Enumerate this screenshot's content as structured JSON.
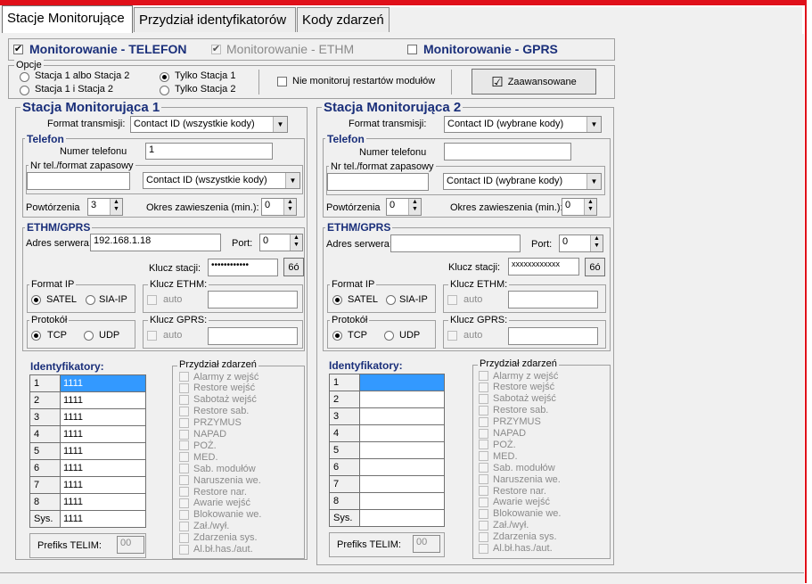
{
  "tabs": [
    {
      "label": "Stacje Monitorujące",
      "active": true
    },
    {
      "label": "Przydział identyfikatorów",
      "active": false
    },
    {
      "label": "Kody zdarzeń",
      "active": false
    }
  ],
  "monitoring": {
    "telefon": {
      "label": "Monitorowanie - TELEFON",
      "checked": true
    },
    "ethm": {
      "label": "Monitorowanie - ETHM",
      "checked": true
    },
    "gprs": {
      "label": "Monitorowanie - GPRS",
      "checked": false
    }
  },
  "options": {
    "legend": "Opcje",
    "r1": "Stacja 1 albo Stacja 2",
    "r2": "Stacja 1 i Stacja 2",
    "r3": "Tylko Stacja 1",
    "r4": "Tylko Stacja 2",
    "no_restart": "Nie monitoruj restartów modułów",
    "advanced": "Zaawansowane"
  },
  "labels": {
    "format_transmisji": "Format transmisji:",
    "telefon": "Telefon",
    "numer_telefonu": "Numer telefonu",
    "nr_zapasowy": "Nr tel./format zapasowy",
    "powtorzenia": "Powtórzenia",
    "okres": "Okres zawieszenia (min.):",
    "ethm_gprs": "ETHM/GPRS",
    "adres": "Adres serwera:",
    "port": "Port:",
    "klucz_stacji": "Klucz stacji:",
    "format_ip": "Format IP",
    "satel": "SATEL",
    "siaip": "SIA-IP",
    "klucz_ethm": "Klucz ETHM:",
    "auto": "auto",
    "protokol": "Protokół",
    "tcp": "TCP",
    "udp": "UDP",
    "klucz_gprs": "Klucz GPRS:",
    "identyfikatory": "Identyfikatory:",
    "przydzial": "Przydział zdarzeń",
    "prefiks": "Prefiks TELIM:",
    "key_button": "6ó"
  },
  "events": [
    "Alarmy z wejść",
    "Restore wejść",
    "Sabotaż wejść",
    "Restore sab.",
    "PRZYMUS",
    "NAPAD",
    "POŻ.",
    "MED.",
    "Sab. modułów",
    "Naruszenia we.",
    "Restore nar.",
    "Awarie wejść",
    "Blokowanie we.",
    "Zał./wył.",
    "Zdarzenia sys.",
    "Al.bł.has./aut."
  ],
  "id_labels": [
    "1",
    "2",
    "3",
    "4",
    "5",
    "6",
    "7",
    "8",
    "Sys."
  ],
  "station1": {
    "title": "Stacja Monitorująca 1",
    "format": "Contact ID (wszystkie kody)",
    "phone": "1",
    "backup_number": "",
    "backup_format": "Contact ID (wszystkie kody)",
    "repeats": "3",
    "suspend": "0",
    "server": "192.168.1.18",
    "port": "0",
    "key": "••••••••••••",
    "ids": [
      "1111",
      "1111",
      "1111",
      "1111",
      "1111",
      "1111",
      "1111",
      "1111",
      "1111"
    ],
    "telim": "00"
  },
  "station2": {
    "title": "Stacja Monitorująca 2",
    "format": "Contact ID (wybrane kody)",
    "phone": "",
    "backup_number": "",
    "backup_format": "Contact ID (wybrane kody)",
    "repeats": "0",
    "suspend": "0",
    "server": "",
    "port": "0",
    "key": "xxxxxxxxxxxx",
    "ids": [
      "",
      "",
      "",
      "",
      "",
      "",
      "",
      "",
      ""
    ],
    "telim": "00"
  }
}
